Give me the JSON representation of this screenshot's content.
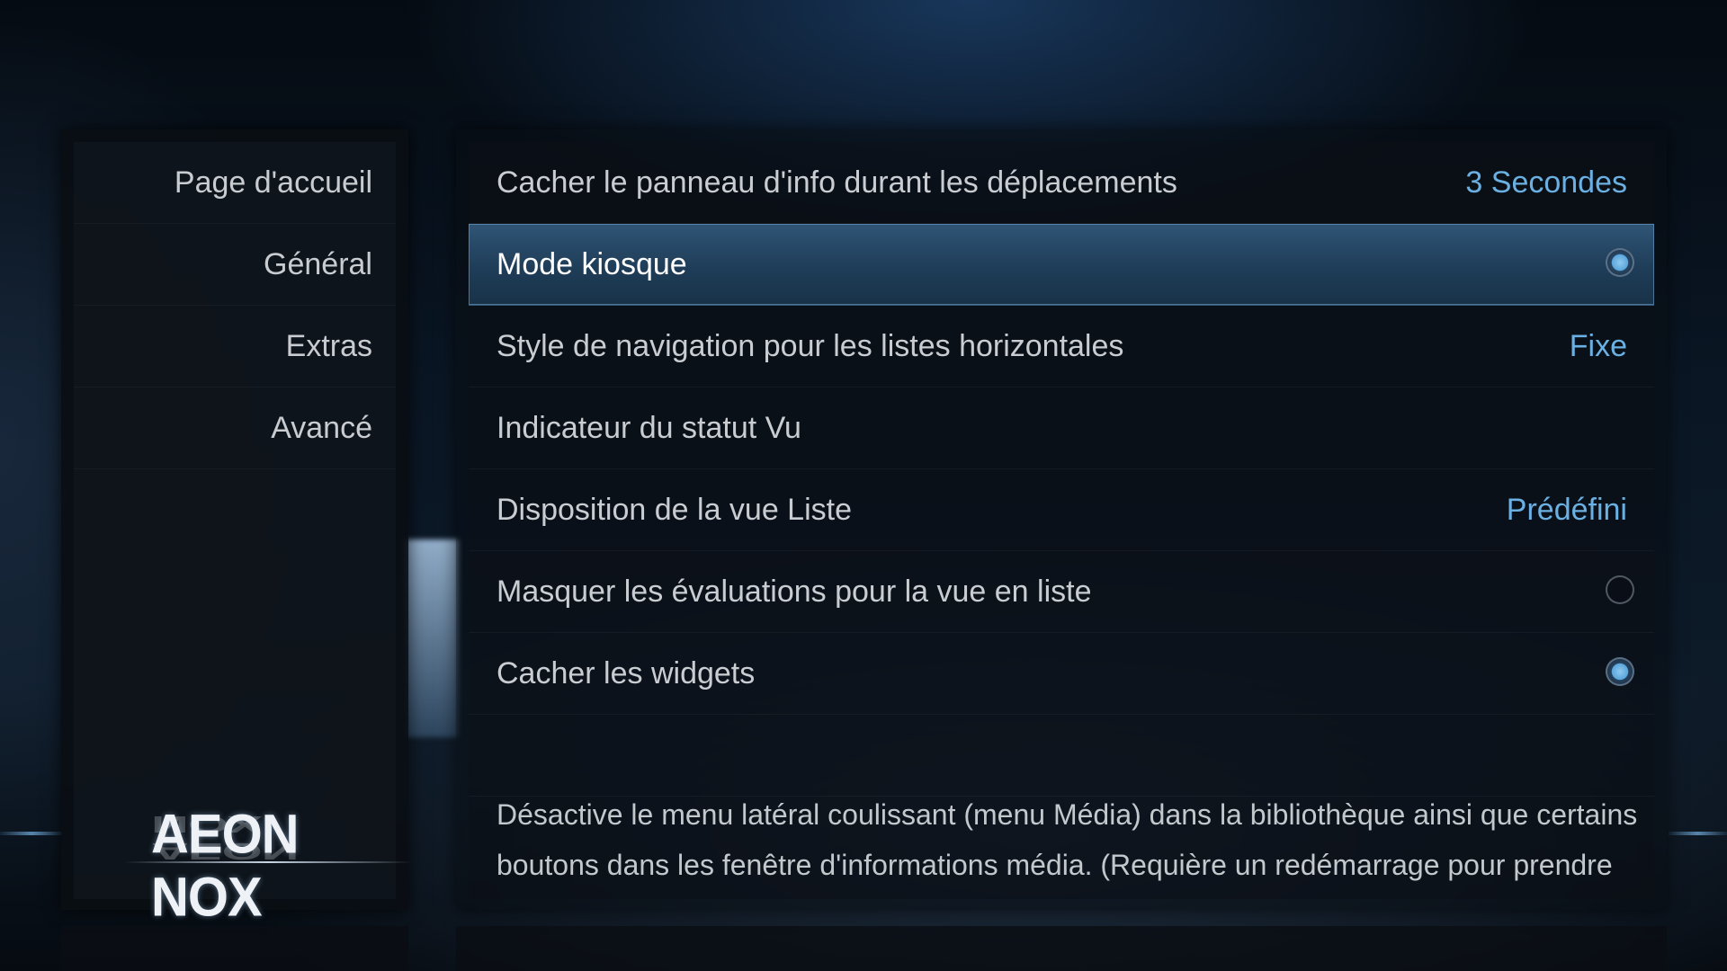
{
  "sidebar": {
    "items": [
      {
        "label": "Page d'accueil"
      },
      {
        "label": "Général"
      },
      {
        "label": "Extras"
      },
      {
        "label": "Avancé"
      }
    ],
    "logo_text": "AEON NOX"
  },
  "settings": {
    "rows": [
      {
        "label": "Cacher le panneau d'info durant les déplacements",
        "value": "3 Secondes"
      },
      {
        "label": "Mode kiosque",
        "toggle": true,
        "focused": true
      },
      {
        "label": "Style de navigation pour les listes horizontales",
        "value": "Fixe"
      },
      {
        "label": "Indicateur du statut Vu"
      },
      {
        "label": "Disposition de la vue Liste",
        "value": "Prédéfini"
      },
      {
        "label": "Masquer les évaluations pour la vue en liste",
        "toggle": false
      },
      {
        "label": "Cacher les widgets",
        "toggle": true
      }
    ],
    "description": "Désactive le menu latéral coulissant (menu Média) dans la bibliothèque ainsi que certains boutons dans les fenêtre d'informations média. (Requière un redémarrage pour prendre"
  },
  "colors": {
    "accent_value": "#6ab0e2",
    "focus_bar": "#2f5576",
    "background": "#0a1624"
  }
}
